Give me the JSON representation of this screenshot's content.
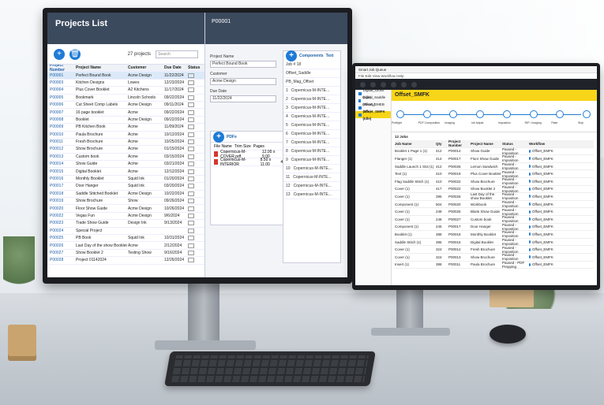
{
  "left_app": {
    "title": "Projects List",
    "count_label": "27 projects",
    "search_placeholder": "Search",
    "columns": [
      "Project Number",
      "Project Name",
      "Customer",
      "Due Date",
      "Status"
    ],
    "rows": [
      [
        "P00001",
        "Perfect Bound Book",
        "Acme Design",
        "11/22/2024"
      ],
      [
        "P00003",
        "Kitchen Designs",
        "Lowes",
        "12/23/2024"
      ],
      [
        "P00004",
        "Plus Cover Booklet",
        "A2 Kitchens",
        "11/17/2024"
      ],
      [
        "P00005",
        "Bookmark",
        "Lincoln Schools",
        "09/22/2024"
      ],
      [
        "P00006",
        "Cut Sheet Comp Labels",
        "Acme Design",
        "09/11/2024"
      ],
      [
        "P00007",
        "16 page booklet",
        "Acme",
        "09/22/2024"
      ],
      [
        "P00008",
        "Booklet",
        "Acme Design",
        "09/22/2024"
      ],
      [
        "P00009",
        "PB Kitchen Book",
        "Acme",
        "11/09/2024"
      ],
      [
        "P00010",
        "Paula Brochure",
        "Acme",
        "10/12/2024"
      ],
      [
        "P00011",
        "Fresh Brochure",
        "Acme",
        "10/25/2024"
      ],
      [
        "P00012",
        "Show Brochure",
        "Acme",
        "01/15/2024"
      ],
      [
        "P00013",
        "Custom book",
        "Acme",
        "03/15/2024"
      ],
      [
        "P00014",
        "Show Guide",
        "Acme",
        "03/21/2024"
      ],
      [
        "P00015",
        "Digital Booklet",
        "Acme",
        "12/12/2024"
      ],
      [
        "P00016",
        "Monthly Booklet",
        "Squid Ink",
        "01/20/2024"
      ],
      [
        "P00017",
        "Door Hanger",
        "Squid Ink",
        "03/20/2024"
      ],
      [
        "P00018",
        "Saddle Stitched Booklet",
        "Acme Design",
        "10/22/2024"
      ],
      [
        "P00019",
        "Show Brochure",
        "Show",
        "09/26/2024"
      ],
      [
        "P00020",
        "Floor Show Guide",
        "Acme Design",
        "10/26/2024"
      ],
      [
        "P00022",
        "Vegas Fun",
        "Acme Design",
        "9/6/2024"
      ],
      [
        "P00023",
        "Trade Show Guide",
        "Design Ink",
        "9/13/2024"
      ],
      [
        "P00024",
        "Special Project",
        "",
        ""
      ],
      [
        "P00025",
        "PB Book",
        "Squid Ink",
        "10/31/2024"
      ],
      [
        "P00026",
        "Last Day of the show Booklet",
        "Acme",
        "2/12/2024"
      ],
      [
        "P00027",
        "Show Booklet 2",
        "Testing Show",
        "9/16/2024"
      ],
      [
        "P00028",
        "Project 01142024",
        "",
        "12/26/2024"
      ]
    ],
    "detail": {
      "header": "P00001",
      "fields": [
        {
          "label": "Project Name",
          "value": "Perfect Bound Book"
        },
        {
          "label": "Customer",
          "value": "Acme Design"
        },
        {
          "label": "Due Date",
          "value": "11/22/2024"
        }
      ],
      "pdfs_title": "PDFs",
      "pdf_columns": [
        "File Name",
        "Trim Size",
        "Pages"
      ],
      "pdfs": [
        {
          "name": "Copernicus-M-COVER.pdf",
          "size": "12.00 x 9.00",
          "pages": "4"
        },
        {
          "name": "Copernicus-M-INTERIOR",
          "size": "8.50 x 11.00",
          "pages": "40"
        }
      ],
      "components_title": "Components",
      "components_type": "Text",
      "components_rows": [
        "1",
        "2",
        "3",
        "4",
        "5",
        "6",
        "7",
        "8",
        "9",
        "10",
        "11",
        "12",
        "13"
      ],
      "component_name": "Copernicus-M-INTE...",
      "job_label": "Job # 18",
      "job_items": [
        "Offset_Saddle",
        "PB_Mag_Offset"
      ]
    }
  },
  "right_app": {
    "window_title": "Smart Job Queue",
    "menu": [
      "File",
      "Edit",
      "View",
      "Workflow",
      "Help"
    ],
    "sidebar": [
      {
        "label": "Digital_Gloss (Idle)",
        "active": false
      },
      {
        "label": "Digital_Saddle (Ready)",
        "active": false
      },
      {
        "label": "Offset_EMEB (Idle)",
        "active": false
      },
      {
        "label": "Offset_SMFK (Idle)",
        "active": true
      }
    ],
    "banner": "Offset_SMFK",
    "flow_nodes": [
      "Preflight",
      "PDF Composition",
      "Imaging",
      "Ink Adjust",
      "Imposition",
      "RIP / Imaging",
      "Plate",
      "Ship"
    ],
    "jobs_title": "12 Jobs",
    "job_columns": [
      "Job Name",
      "Qty",
      "Project Number",
      "Project Name",
      "Status",
      "Workflow"
    ],
    "jobs": [
      [
        "Booklet 1 Page 1 (1)",
        "412",
        "P00014",
        "Show Guide",
        "Paused - Imposition",
        "Offset_EMFK"
      ],
      [
        "Flanger (1)",
        "414",
        "P00017",
        "Floor Show Guide",
        "Paused - Imposition",
        "Offset_EMFK"
      ],
      [
        "Saddle Launch 1 Slot (1)",
        "412",
        "P00026",
        "Lemon Sandwich",
        "Paused - Imposition",
        "Offset_EMFK"
      ],
      [
        "Text (1)",
        "410",
        "P00019",
        "Plus Cover Booklet",
        "Paused - Imposition",
        "Offset_EMFK"
      ],
      [
        "Flag Saddle Stitch (1)",
        "410",
        "P00022",
        "Show Brochure",
        "Paused - Imposition",
        "Offset_EMFK"
      ],
      [
        "Cover (1)",
        "417",
        "P00022",
        "Show Booklet 2",
        "Paused - Imposition",
        "Offset_EMFK"
      ],
      [
        "Cover (1)",
        "395",
        "P00026",
        "Last Day of the show Booklet",
        "Paused - Imposition",
        "Offset_EMFK"
      ],
      [
        "Component (1)",
        "504",
        "P00020",
        "Workbook",
        "Paused - Imposition",
        "Offset_EMFK"
      ],
      [
        "Cover (1)",
        "248",
        "P00025",
        "Blank Show Guide",
        "Paused - Imposition",
        "Offset_EMFK"
      ],
      [
        "Cover (1)",
        "248",
        "P00027",
        "Custom book",
        "Paused - Imposition",
        "Offset_EMFK"
      ],
      [
        "Component (1)",
        "245",
        "P00017",
        "Door Hanger",
        "Paused - Imposition",
        "Offset_EMFK"
      ],
      [
        "Booklet (1)",
        "388",
        "P00018",
        "Monthly Booklet",
        "Paused - Imposition",
        "Offset_EMFK"
      ],
      [
        "Saddle Stitch (1)",
        "395",
        "P00015",
        "Digital Booklet",
        "Paused - Imposition",
        "Offset_EMFK"
      ],
      [
        "Cover (1)",
        "324",
        "P00012",
        "Fresh Brochure",
        "Paused - Imposition",
        "Offset_EMFK"
      ],
      [
        "Cover (1)",
        "324",
        "P00013",
        "Show Brochure",
        "Paused - Imposition",
        "Offset_EMFK"
      ],
      [
        "Insert (1)",
        "388",
        "P00011",
        "Paula Brochure",
        "Paused - PDF Prepping",
        "Offset_EMFK"
      ]
    ]
  },
  "colors": {
    "accent": "#1f7bd6",
    "banner": "#f7d518",
    "header_dark": "#3c4a5e"
  }
}
